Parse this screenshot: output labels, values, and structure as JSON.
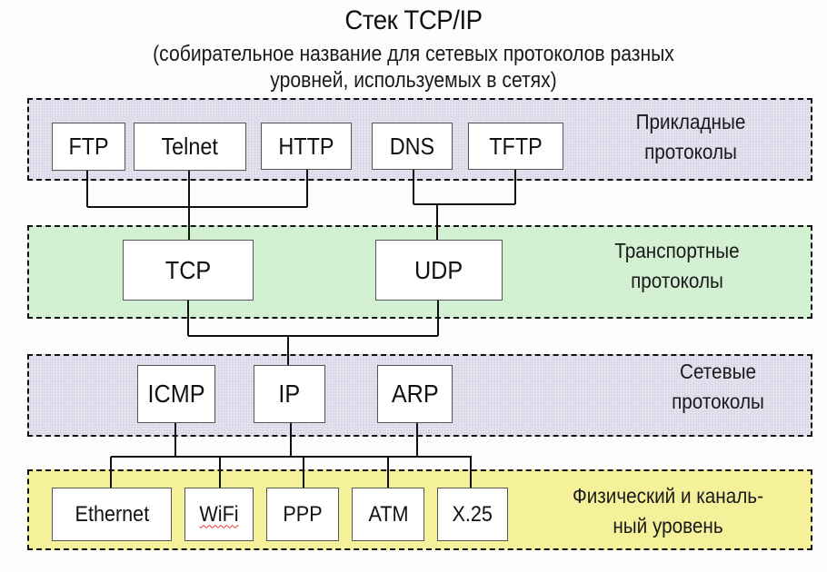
{
  "title": "Стек TCP/IP",
  "subtitle": {
    "line1": "(собирательное название для сетевых протоколов разных",
    "line2": "уровней, используемых в сетях)"
  },
  "layers": {
    "application": {
      "label_line1": "Прикладные",
      "label_line2": "протоколы",
      "color": "#d9d7e8",
      "protocols": [
        "FTP",
        "Telnet",
        "HTTP",
        "DNS",
        "TFTP"
      ]
    },
    "transport": {
      "label_line1": "Транспортные",
      "label_line2": "протоколы",
      "color": "#d4f0d2",
      "protocols": [
        "TCP",
        "UDP"
      ]
    },
    "network": {
      "label_line1": "Сетевые",
      "label_line2": "протоколы",
      "color": "#d9d7e8",
      "protocols": [
        "ICMP",
        "IP",
        "ARP"
      ]
    },
    "link": {
      "label_line1": "Физический и каналь-",
      "label_line2": "ный уровень",
      "color": "#f5f09a",
      "protocols": [
        "Ethernet",
        "WiFi",
        "PPP",
        "ATM",
        "X.25"
      ]
    }
  },
  "connections": [
    {
      "from": [
        "FTP",
        "Telnet",
        "HTTP"
      ],
      "to": "TCP"
    },
    {
      "from": [
        "DNS",
        "TFTP"
      ],
      "to": "UDP"
    },
    {
      "from": [
        "TCP",
        "UDP"
      ],
      "to": "IP"
    },
    {
      "from": [
        "ICMP",
        "IP",
        "ARP"
      ],
      "to": [
        "Ethernet",
        "WiFi",
        "PPP",
        "ATM",
        "X.25"
      ]
    }
  ]
}
